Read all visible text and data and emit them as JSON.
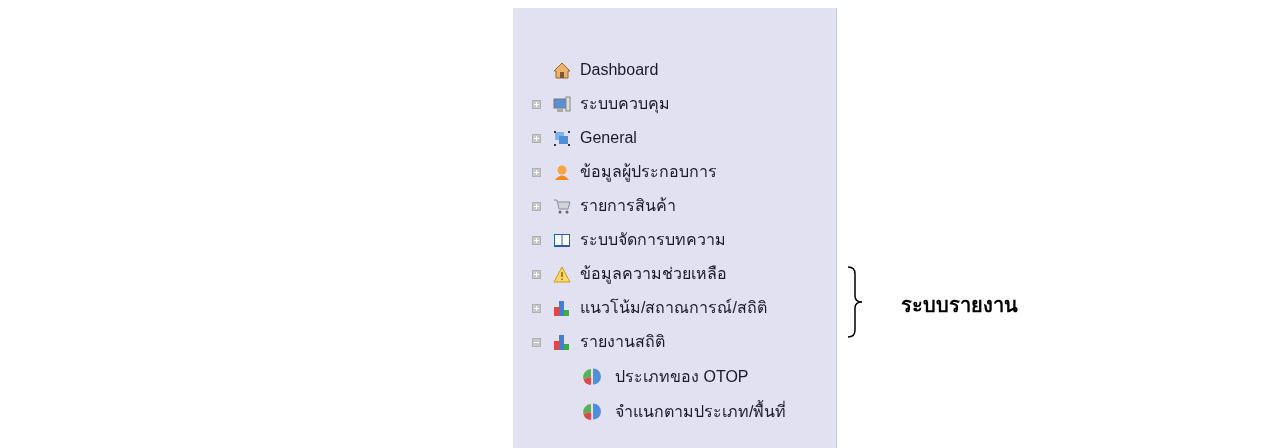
{
  "menu": {
    "items": [
      {
        "label": "Dashboard"
      },
      {
        "label": "ระบบควบคุม",
        "expanded": false
      },
      {
        "label": "General",
        "expanded": false
      },
      {
        "label": "ข้อมูลผู้ประกอบการ",
        "expanded": false
      },
      {
        "label": "รายการสินค้า",
        "expanded": false
      },
      {
        "label": "ระบบจัดการบทความ",
        "expanded": false
      },
      {
        "label": "ข้อมูลความช่วยเหลือ",
        "expanded": false
      },
      {
        "label": "แนวโน้ม/สถาณการณ์/สถิติ",
        "expanded": false
      },
      {
        "label": "รายงานสถิติ",
        "expanded": true,
        "children": [
          {
            "label": "ประเภทของ OTOP"
          },
          {
            "label": "จำแนกตามประเภท/พื้นที่"
          }
        ]
      }
    ]
  },
  "annotation": "ระบบรายงาน"
}
